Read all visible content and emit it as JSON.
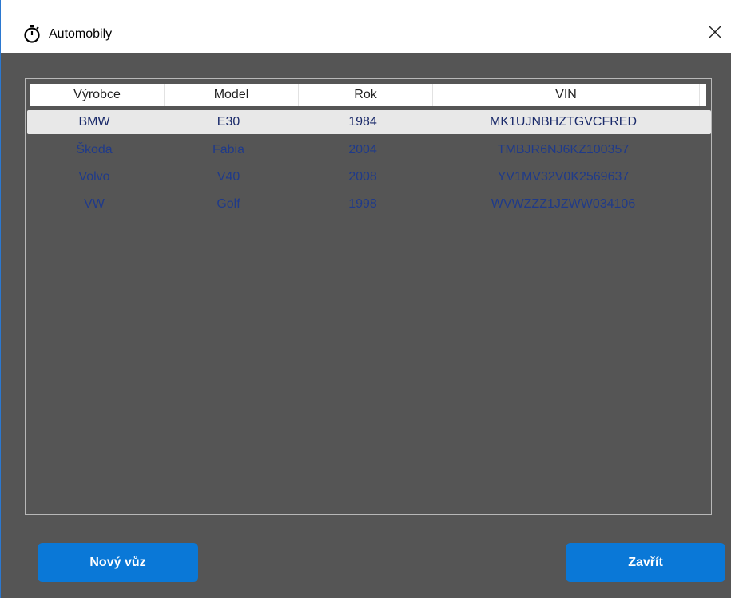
{
  "window": {
    "title": "Automobily",
    "close_glyph": "✕",
    "title_icon": "stopwatch-icon"
  },
  "table": {
    "columns": [
      "Výrobce",
      "Model",
      "Rok",
      "VIN"
    ],
    "rows": [
      [
        "BMW",
        "E30",
        "1984",
        "MK1UJNBHZTGVCFRED"
      ],
      [
        "Škoda",
        "Fabia",
        "2004",
        "TMBJR6NJ6KZ100357"
      ],
      [
        "Volvo",
        "V40",
        "2008",
        "YV1MV32V0K2569637"
      ],
      [
        "VW",
        "Golf",
        "1998",
        "WVWZZZ1JZWW034106"
      ]
    ],
    "selected_row": 0
  },
  "buttons": {
    "new_car": "Nový vůz",
    "close": "Zavřít"
  },
  "colors": {
    "accent": "#0a78d7",
    "background": "#555555",
    "row_text": "#1f3a8a"
  }
}
